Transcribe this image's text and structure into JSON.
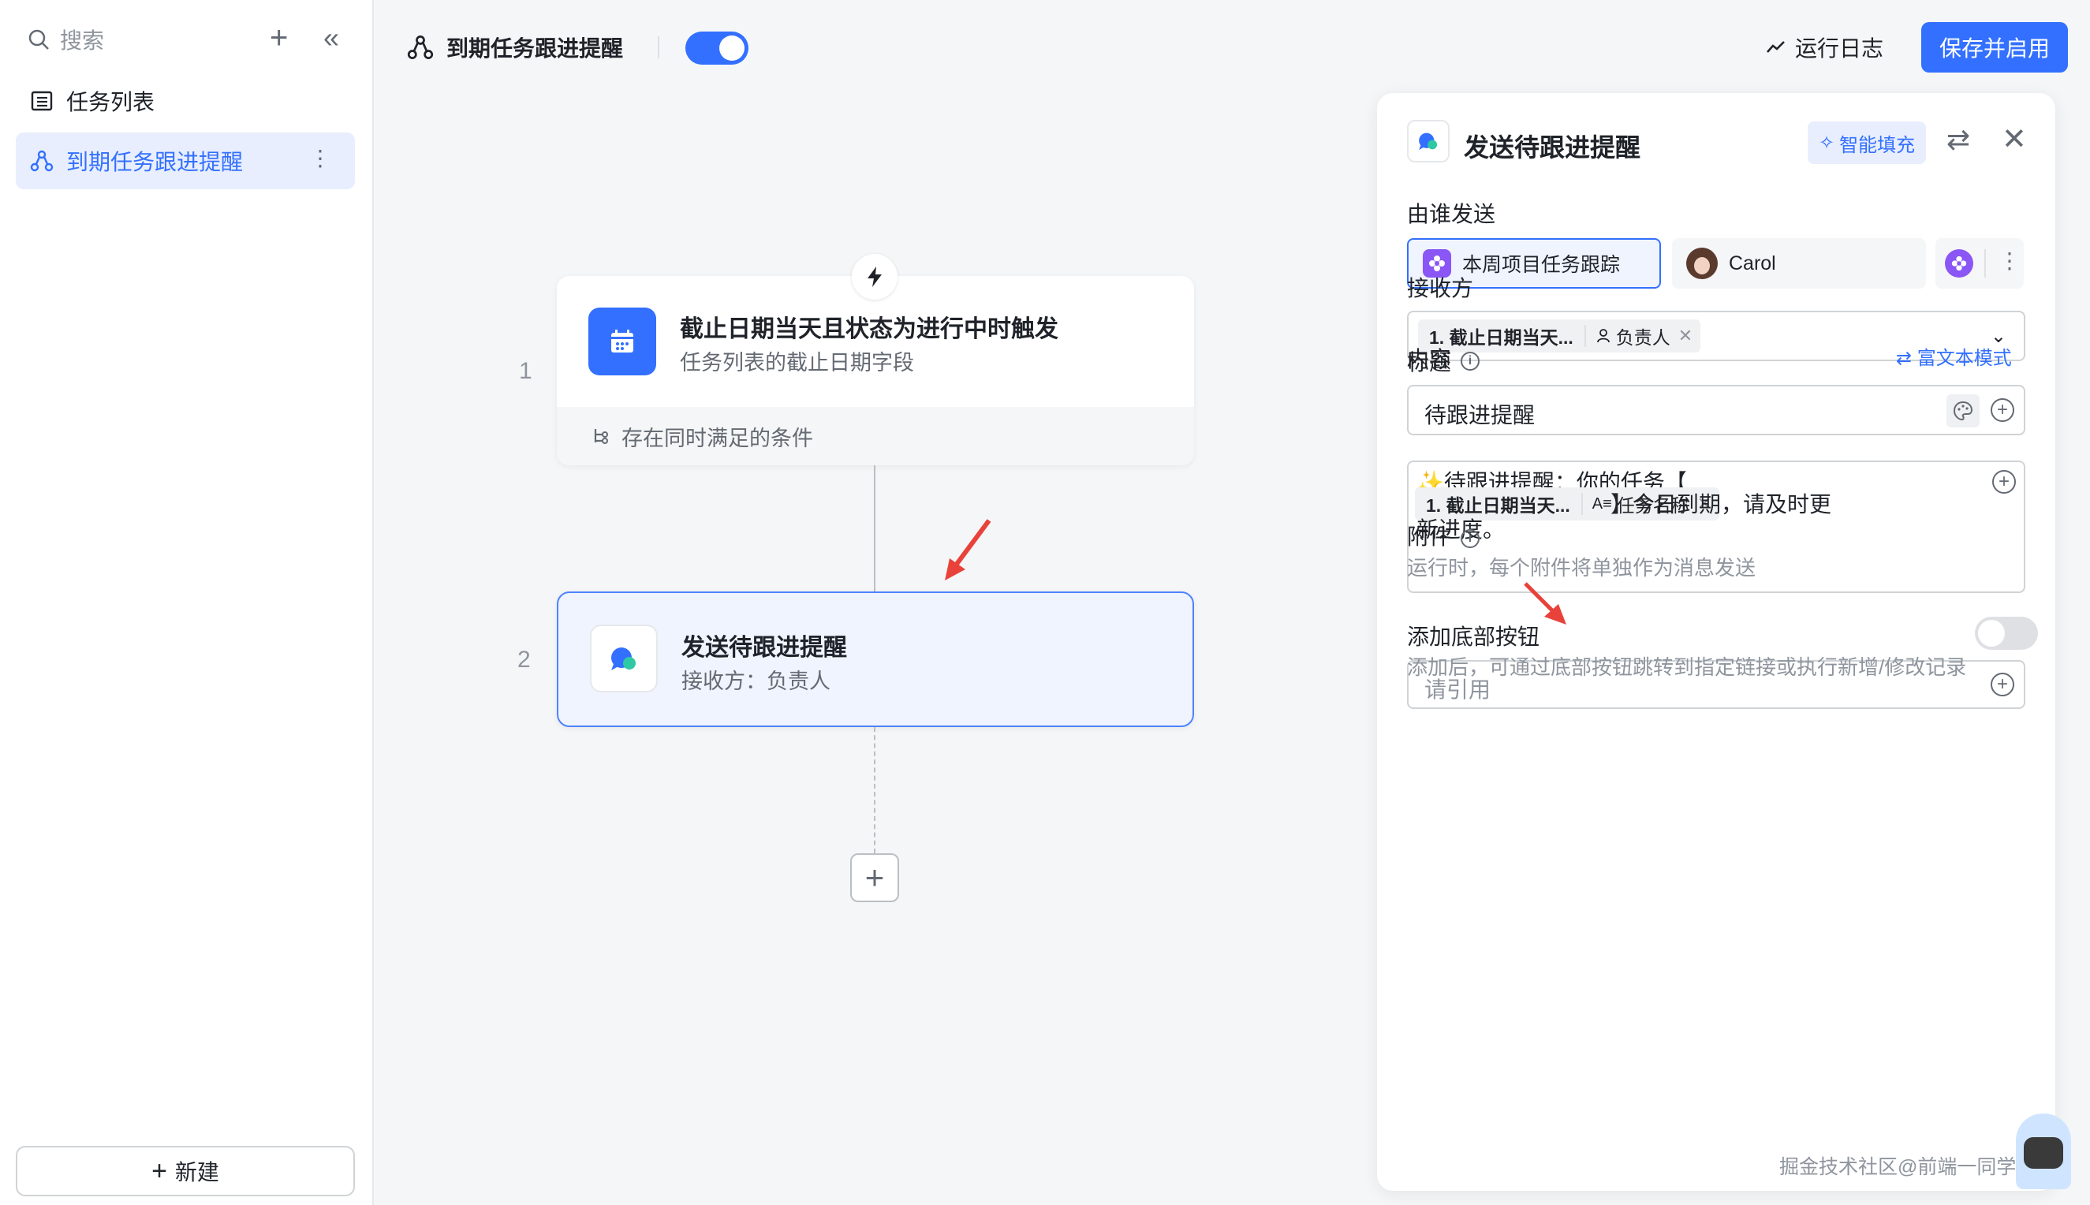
{
  "sidebar": {
    "search_placeholder": "搜索",
    "items": [
      {
        "label": "任务列表",
        "icon": "table-icon"
      },
      {
        "label": "到期任务跟进提醒",
        "icon": "workflow-icon"
      }
    ],
    "new_button": "新建"
  },
  "topbar": {
    "flow_title": "到期任务跟进提醒",
    "enabled": true,
    "run_log": "运行日志",
    "save_button": "保存并启用"
  },
  "canvas": {
    "steps": [
      {
        "number": "1",
        "title": "截止日期当天且状态为进行中时触发",
        "subtitle": "任务列表的截止日期字段",
        "footer": "存在同时满足的条件"
      },
      {
        "number": "2",
        "title": "发送待跟进提醒",
        "subtitle": "接收方：负责人"
      }
    ]
  },
  "panel": {
    "title": "发送待跟进提醒",
    "smart_fill": "智能填充",
    "sender_label": "由谁发送",
    "senders": [
      "本周项目任务跟踪",
      "Carol"
    ],
    "receiver_label": "接收方",
    "receiver_tag": {
      "source": "1. 截止日期当天...",
      "field": "负责人"
    },
    "title_label": "标题",
    "title_value": "待跟进提醒",
    "content_label": "内容",
    "rich_text_mode": "富文本模式",
    "content": {
      "line1": "✨待跟进提醒：你的任务【",
      "tag_source": "1. 截止日期当天...",
      "tag_field": "任务名称",
      "line2_after": "】今日到期，请及时更",
      "line3": "新进度。"
    },
    "attach_label": "附件",
    "attach_hint": "运行时，每个附件将单独作为消息发送",
    "attach_placeholder": "请引用",
    "bottom_button_label": "添加底部按钮",
    "bottom_button_enabled": false,
    "bottom_button_hint": "添加后，可通过底部按钮跳转到指定链接或执行新增/修改记录"
  },
  "watermark": "掘金技术社区@前端一同学Zoran",
  "colors": {
    "accent": "#3370ff",
    "selected_bg": "#f0f4ff",
    "app_purple": "#8a56f5",
    "annotation_red": "#e8423a"
  }
}
